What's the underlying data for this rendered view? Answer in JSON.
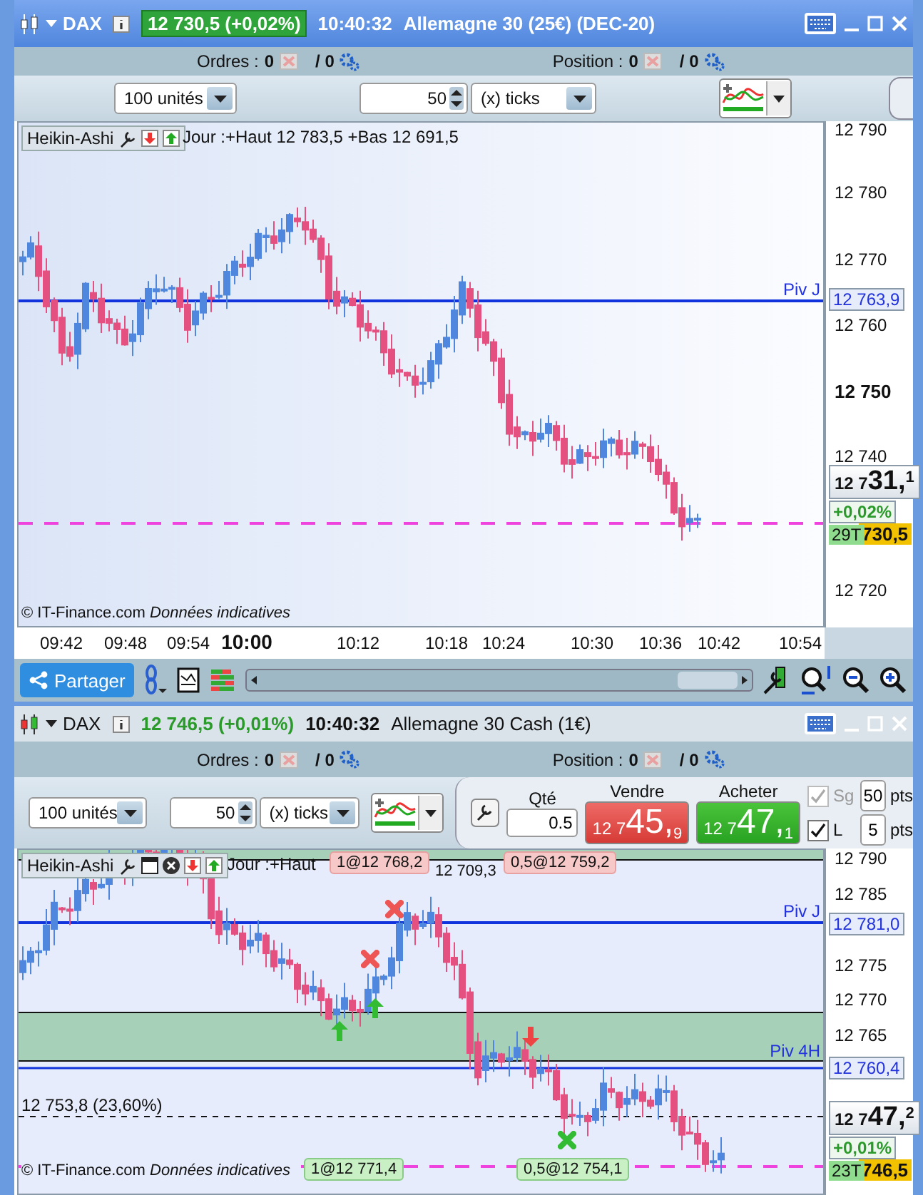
{
  "windows": [
    {
      "title_bar": {
        "symbol": "DAX",
        "quote": "12 730,5 (+0,02%)",
        "time": "10:40:32",
        "instrument": "Allemagne 30 (25€) (DEC-20)",
        "active": true
      },
      "orders": {
        "label": "Ordres :",
        "count": "0",
        "total": "/ 0"
      },
      "position": {
        "label": "Position :",
        "count": "0",
        "total": "/ 0"
      },
      "toolbar": {
        "quantity": "100 unités",
        "step": "50",
        "step_unit": "(x) ticks"
      },
      "chart": {
        "style": "Heikin-Ashi",
        "range": "Jour :+Haut 12 783,5 +Bas 12 691,5",
        "price_ticks": [
          {
            "label": "12 790",
            "major": false
          },
          {
            "label": "12 780",
            "major": false
          },
          {
            "label": "12 770",
            "major": false
          },
          {
            "label": "12 760",
            "major": false
          },
          {
            "label": "12 750",
            "major": true
          },
          {
            "label": "12 740",
            "major": false
          },
          {
            "label": "12 720",
            "major": false
          }
        ],
        "levels": [
          {
            "name": "Piv J",
            "price": "12 763,9"
          }
        ],
        "last": {
          "prefix": "12 7",
          "digits": "31,",
          "fraction": "1",
          "change": "+0,02%",
          "ticks": "29T",
          "price": "730,5"
        },
        "copyright": "© IT-Finance.com",
        "disclaimer": "Données indicatives"
      },
      "time_axis": [
        {
          "label": "09:42",
          "major": false
        },
        {
          "label": "09:48",
          "major": false
        },
        {
          "label": "09:54",
          "major": false
        },
        {
          "label": "10:00",
          "major": true
        },
        {
          "label": "10:12",
          "major": false
        },
        {
          "label": "10:18",
          "major": false
        },
        {
          "label": "10:24",
          "major": false
        },
        {
          "label": "10:30",
          "major": false
        },
        {
          "label": "10:36",
          "major": false
        },
        {
          "label": "10:42",
          "major": false
        },
        {
          "label": "10:54",
          "major": false
        }
      ],
      "share_button": "Partager"
    },
    {
      "title_bar": {
        "symbol": "DAX",
        "quote": "12 746,5 (+0,01%)",
        "time": "10:40:32",
        "instrument": "Allemagne 30 Cash (1€)",
        "active": false
      },
      "orders": {
        "label": "Ordres :",
        "count": "0",
        "total": "/ 0"
      },
      "position": {
        "label": "Position :",
        "count": "0",
        "total": "/ 0"
      },
      "toolbar": {
        "quantity": "100 unités",
        "step": "50",
        "step_unit": "(x) ticks"
      },
      "trade": {
        "qty_label": "Qté",
        "qty": "0.5",
        "sell_label": "Vendre",
        "sell": {
          "prefix": "12 7",
          "digits": "45,",
          "fraction": "9"
        },
        "buy_label": "Acheter",
        "buy": {
          "prefix": "12 7",
          "digits": "47,",
          "fraction": "1"
        },
        "options": [
          {
            "label": "Sg",
            "checked": true,
            "disabled": true,
            "value": "50",
            "unit": "pts"
          },
          {
            "label": "L",
            "checked": true,
            "disabled": false,
            "value": "5",
            "unit": "pts"
          }
        ]
      },
      "chart": {
        "style": "Heikin-Ashi",
        "range": "Jour :+Haut",
        "top_tags": [
          "1@12 768,2",
          "12 709,3",
          "0,5@12 759,2"
        ],
        "price_ticks": [
          {
            "label": "12 790",
            "major": false
          },
          {
            "label": "12 785",
            "major": false
          },
          {
            "label": "12 775",
            "major": false
          },
          {
            "label": "12 770",
            "major": false
          },
          {
            "label": "12 765",
            "major": false
          }
        ],
        "levels": [
          {
            "name": "Piv J",
            "price": "12 781,0"
          },
          {
            "name": "Piv 4H",
            "price": "12 760,4"
          }
        ],
        "fib": "12 753,8 (23,60%)",
        "bottom_tags": [
          "1@12 771,4",
          "0,5@12 754,1"
        ],
        "last": {
          "prefix": "12 7",
          "digits": "47,",
          "fraction": "2",
          "change": "+0,01%",
          "ticks": "23T",
          "price": "746,5"
        },
        "copyright": "© IT-Finance.com",
        "disclaimer": "Données indicatives"
      }
    }
  ]
}
